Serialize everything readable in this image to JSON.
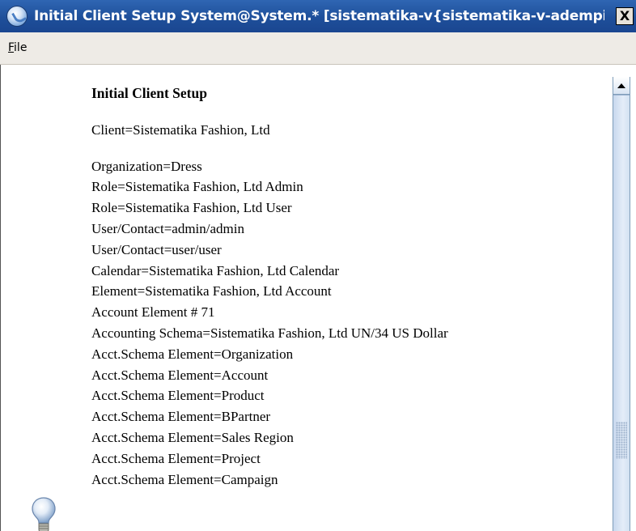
{
  "window": {
    "title": "Initial Client Setup  System@System.* [sistematika-v{sistematika-v-adempiere-a...",
    "close_label": "X"
  },
  "menubar": {
    "file_label_mnemonic": "F",
    "file_label_rest": "ile"
  },
  "content": {
    "heading": "Initial Client Setup",
    "client": "Client=Sistematika Fashion, Ltd",
    "lines": [
      "Organization=Dress",
      "Role=Sistematika Fashion, Ltd Admin",
      "Role=Sistematika Fashion, Ltd User",
      "User/Contact=admin/admin",
      "User/Contact=user/user",
      "Calendar=Sistematika Fashion, Ltd Calendar",
      "Element=Sistematika Fashion, Ltd Account",
      "Account Element # 71",
      "Accounting Schema=Sistematika Fashion, Ltd UN/34 US Dollar",
      "Acct.Schema Element=Organization",
      "Acct.Schema Element=Account",
      "Acct.Schema Element=Product",
      "Acct.Schema Element=BPartner",
      "Acct.Schema Element=Sales Region",
      "Acct.Schema Element=Project",
      "Acct.Schema Element=Campaign"
    ]
  },
  "icons": {
    "app": "app-icon",
    "info": "lightbulb-icon",
    "scroll_up": "arrow-up-icon"
  },
  "colors": {
    "titlebar": "#1e4f9a",
    "menubar": "#eeebe6"
  }
}
